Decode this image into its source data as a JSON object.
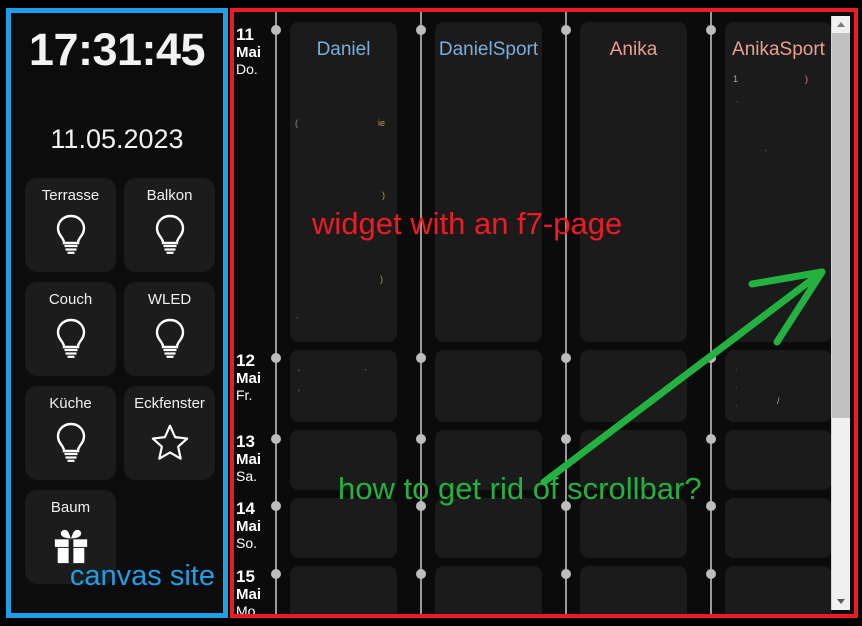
{
  "canvas_panel": {
    "border_color": "#1f9ee8",
    "caption": "canvas site",
    "clock": {
      "time": "17:31:45",
      "date": "11.05.2023"
    },
    "tiles": [
      {
        "label": "Terrasse",
        "icon": "lightbulb-icon"
      },
      {
        "label": "Balkon",
        "icon": "lightbulb-icon"
      },
      {
        "label": "Couch",
        "icon": "lightbulb-icon"
      },
      {
        "label": "WLED",
        "icon": "lightbulb-icon"
      },
      {
        "label": "Küche",
        "icon": "lightbulb-icon"
      },
      {
        "label": "Eckfenster",
        "icon": "star-icon"
      },
      {
        "label": "Baum",
        "icon": "gift-icon"
      }
    ]
  },
  "widget_panel": {
    "border_color": "#ed1b24",
    "annotations": {
      "red": "widget with an f7-page",
      "green": "how to get rid of scrollbar?",
      "red_color": "#ed1b24",
      "green_color": "#23b23f"
    },
    "calendar": {
      "dates": [
        {
          "day": "11",
          "month": "Mai",
          "weekday": "Do."
        },
        {
          "day": "12",
          "month": "Mai",
          "weekday": "Fr."
        },
        {
          "day": "13",
          "month": "Mai",
          "weekday": "Sa."
        },
        {
          "day": "14",
          "month": "Mai",
          "weekday": "So."
        },
        {
          "day": "15",
          "month": "Mai",
          "weekday": "Mo."
        }
      ],
      "columns": [
        {
          "title": "Daniel",
          "color": "#7aaedb"
        },
        {
          "title": "DanielSport",
          "color": "#7aaedb"
        },
        {
          "title": "Anika",
          "color": "#e8a08d"
        },
        {
          "title": "AnikaSport",
          "color": "#e8a08d"
        }
      ]
    },
    "scrollbar": {
      "up_arrow": "scroll-up-arrow",
      "down_arrow": "scroll-down-arrow",
      "track_color": "#f0f0f0",
      "thumb_color": "#c1c1c1"
    }
  }
}
